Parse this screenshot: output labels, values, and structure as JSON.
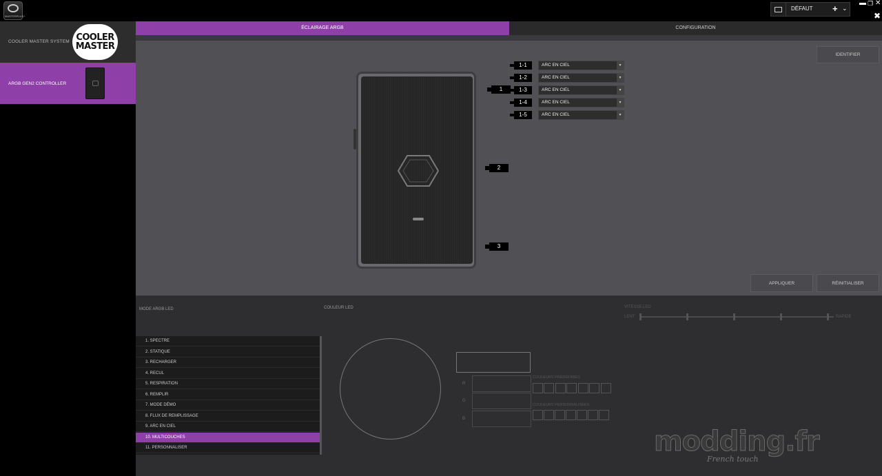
{
  "topbar": {
    "app_logo_text": "MASTERPLUS+",
    "profile_name": "DÉFAUT",
    "add_label": "+",
    "caret": "⌄",
    "window_min": "▬",
    "window_max": "❐",
    "window_close": "✕",
    "panel_close": "✖"
  },
  "sidebar": {
    "system_label": "COOLER MASTER SYSTEM",
    "brand_logo_line1": "COOLER",
    "brand_logo_line2": "MASTER",
    "device_label": "ARGB GEN2 CONTROLLER"
  },
  "tabs": [
    {
      "label": "ÉCLAIRAGE ARGB",
      "active": true
    },
    {
      "label": "CONFIGURATION",
      "active": false
    }
  ],
  "ports": {
    "main": [
      "1",
      "2",
      "3"
    ],
    "sub": [
      {
        "id": "1-1",
        "mode": "ARC EN CIEL"
      },
      {
        "id": "1-2",
        "mode": "ARC EN CIEL"
      },
      {
        "id": "1-3",
        "mode": "ARC EN CIEL"
      },
      {
        "id": "1-4",
        "mode": "ARC EN CIEL"
      },
      {
        "id": "1-5",
        "mode": "ARC EN CIEL"
      }
    ],
    "select_arrow": "▼"
  },
  "buttons": {
    "identify": "IDENTIFIER",
    "apply": "APPLIQUER",
    "reset": "RÉINITIALISER"
  },
  "bottom": {
    "mode_title": "MODE ARGB LED",
    "color_title": "COULEUR LED",
    "speed_title": "VITESSE LED",
    "speed_slow": "LENT",
    "speed_fast": "RAPIDE",
    "preset_title": "COULEURS PRÉDÉFINIES",
    "custom_title": "COULEURS PERSONNALISÉES",
    "rgb_labels": [
      "R",
      "G",
      "B"
    ]
  },
  "modes": [
    {
      "label": "1. SPECTRE",
      "active": false
    },
    {
      "label": "2. STATIQUE",
      "active": false
    },
    {
      "label": "3. RECHARGER",
      "active": false
    },
    {
      "label": "4. RECUL",
      "active": false
    },
    {
      "label": "5. RESPIRATION",
      "active": false
    },
    {
      "label": "6. REMPLIR",
      "active": false
    },
    {
      "label": "7. MODE DÉMO",
      "active": false
    },
    {
      "label": "8. FLUX DE REMPLISSAGE",
      "active": false
    },
    {
      "label": "9. ARC EN CIEL",
      "active": false
    },
    {
      "label": "10. MULTICOUCHES",
      "active": true
    },
    {
      "label": "11. PERSONNALISER",
      "active": false
    }
  ],
  "watermark": {
    "main": "modding.fr",
    "sub": "French touch"
  },
  "colors": {
    "accent": "#8e3fa8",
    "panel": "#515155",
    "bottom_panel": "#2e2e30"
  }
}
